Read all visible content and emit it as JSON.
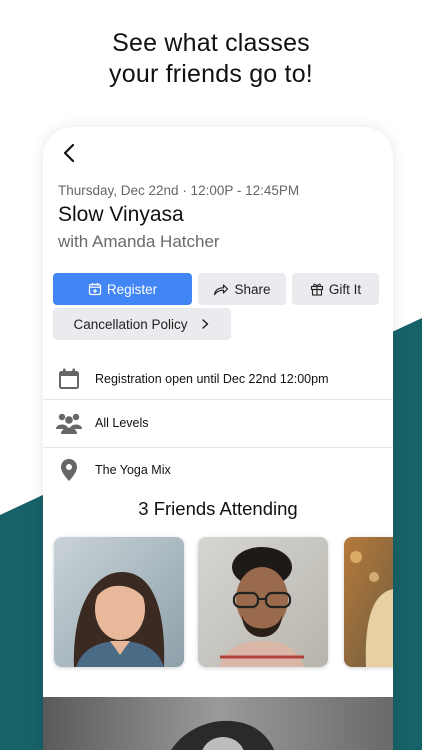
{
  "promo": {
    "line1": "See what classes",
    "line2": "your friends go to!"
  },
  "colors": {
    "teal": "#176168",
    "accent": "#4285f4",
    "button_bg": "#e9ebee",
    "icon_gray": "#666666"
  },
  "class_detail": {
    "datetime": "Thursday, Dec 22nd · 12:00P - 12:45PM",
    "title": "Slow Vinyasa",
    "instructor": "with Amanda Hatcher"
  },
  "actions": {
    "register": {
      "label": "Register",
      "icon": "calendar-plus-icon"
    },
    "share": {
      "label": "Share",
      "icon": "share-arrow-icon"
    },
    "gift": {
      "label": "Gift It",
      "icon": "gift-icon"
    },
    "cancellation": {
      "label": "Cancellation Policy",
      "icon": "chevron-right-icon"
    }
  },
  "info_rows": [
    {
      "icon": "calendar-icon",
      "text": "Registration open until Dec 22nd 12:00pm"
    },
    {
      "icon": "people-group-icon",
      "text": "All Levels"
    },
    {
      "icon": "location-pin-icon",
      "text": "The Yoga Mix"
    }
  ],
  "friends": {
    "heading": "3 Friends Attending",
    "avatars": [
      "friend-photo-woman",
      "friend-photo-man-glasses",
      "friend-photo-woman-blonde"
    ]
  }
}
